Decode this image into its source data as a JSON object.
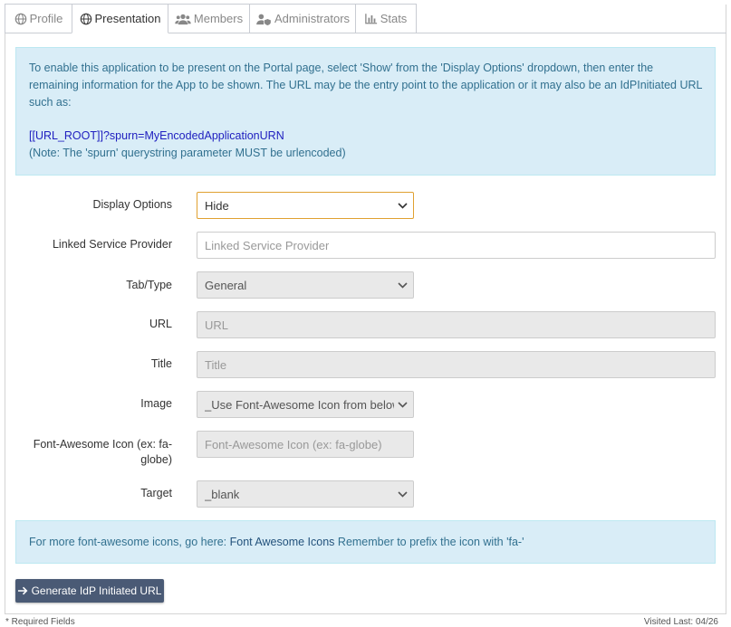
{
  "tabs": [
    {
      "label": "Profile",
      "icon": "globe-icon"
    },
    {
      "label": "Presentation",
      "icon": "globe-icon"
    },
    {
      "label": "Members",
      "icon": "users-icon"
    },
    {
      "label": "Administrators",
      "icon": "user-shield-icon"
    },
    {
      "label": "Stats",
      "icon": "bar-chart-icon"
    }
  ],
  "info": {
    "text": "To enable this application to be present on the Portal page, select 'Show' from the 'Display Options' dropdown, then enter the remaining information for the App to be shown. The URL may be the entry point to the application or it may also be an IdPInitiated URL such as:",
    "url_example": "[[URL_ROOT]]?spurn=MyEncodedApplicationURN",
    "note": "(Note: The 'spurn' querystring parameter MUST be urlencoded)"
  },
  "form": {
    "display_options": {
      "label": "Display Options",
      "value": "Hide"
    },
    "linked_sp": {
      "label": "Linked Service Provider",
      "placeholder": "Linked Service Provider"
    },
    "tab_type": {
      "label": "Tab/Type",
      "value": "General"
    },
    "url": {
      "label": "URL",
      "placeholder": "URL"
    },
    "title": {
      "label": "Title",
      "placeholder": "Title"
    },
    "image": {
      "label": "Image",
      "value": "_Use Font-Awesome Icon from below"
    },
    "fa_icon": {
      "label": "Font-Awesome Icon (ex: fa-globe)",
      "placeholder": "Font-Awesome Icon (ex:  fa-globe)"
    },
    "target": {
      "label": "Target",
      "value": "_blank"
    }
  },
  "help": {
    "prefix": "For more font-awesome icons, go here: ",
    "link": "Font Awesome Icons",
    "suffix": " Remember to prefix the icon with 'fa-'"
  },
  "button": {
    "label": "Generate IdP Initiated URL"
  },
  "footer": {
    "left": "* Required Fields",
    "right": "Visited Last: 04/26"
  },
  "colors": {
    "accent": "#4a5a75",
    "info_bg": "#d9edf7",
    "info_text": "#31708f",
    "focus": "#e0a030"
  }
}
